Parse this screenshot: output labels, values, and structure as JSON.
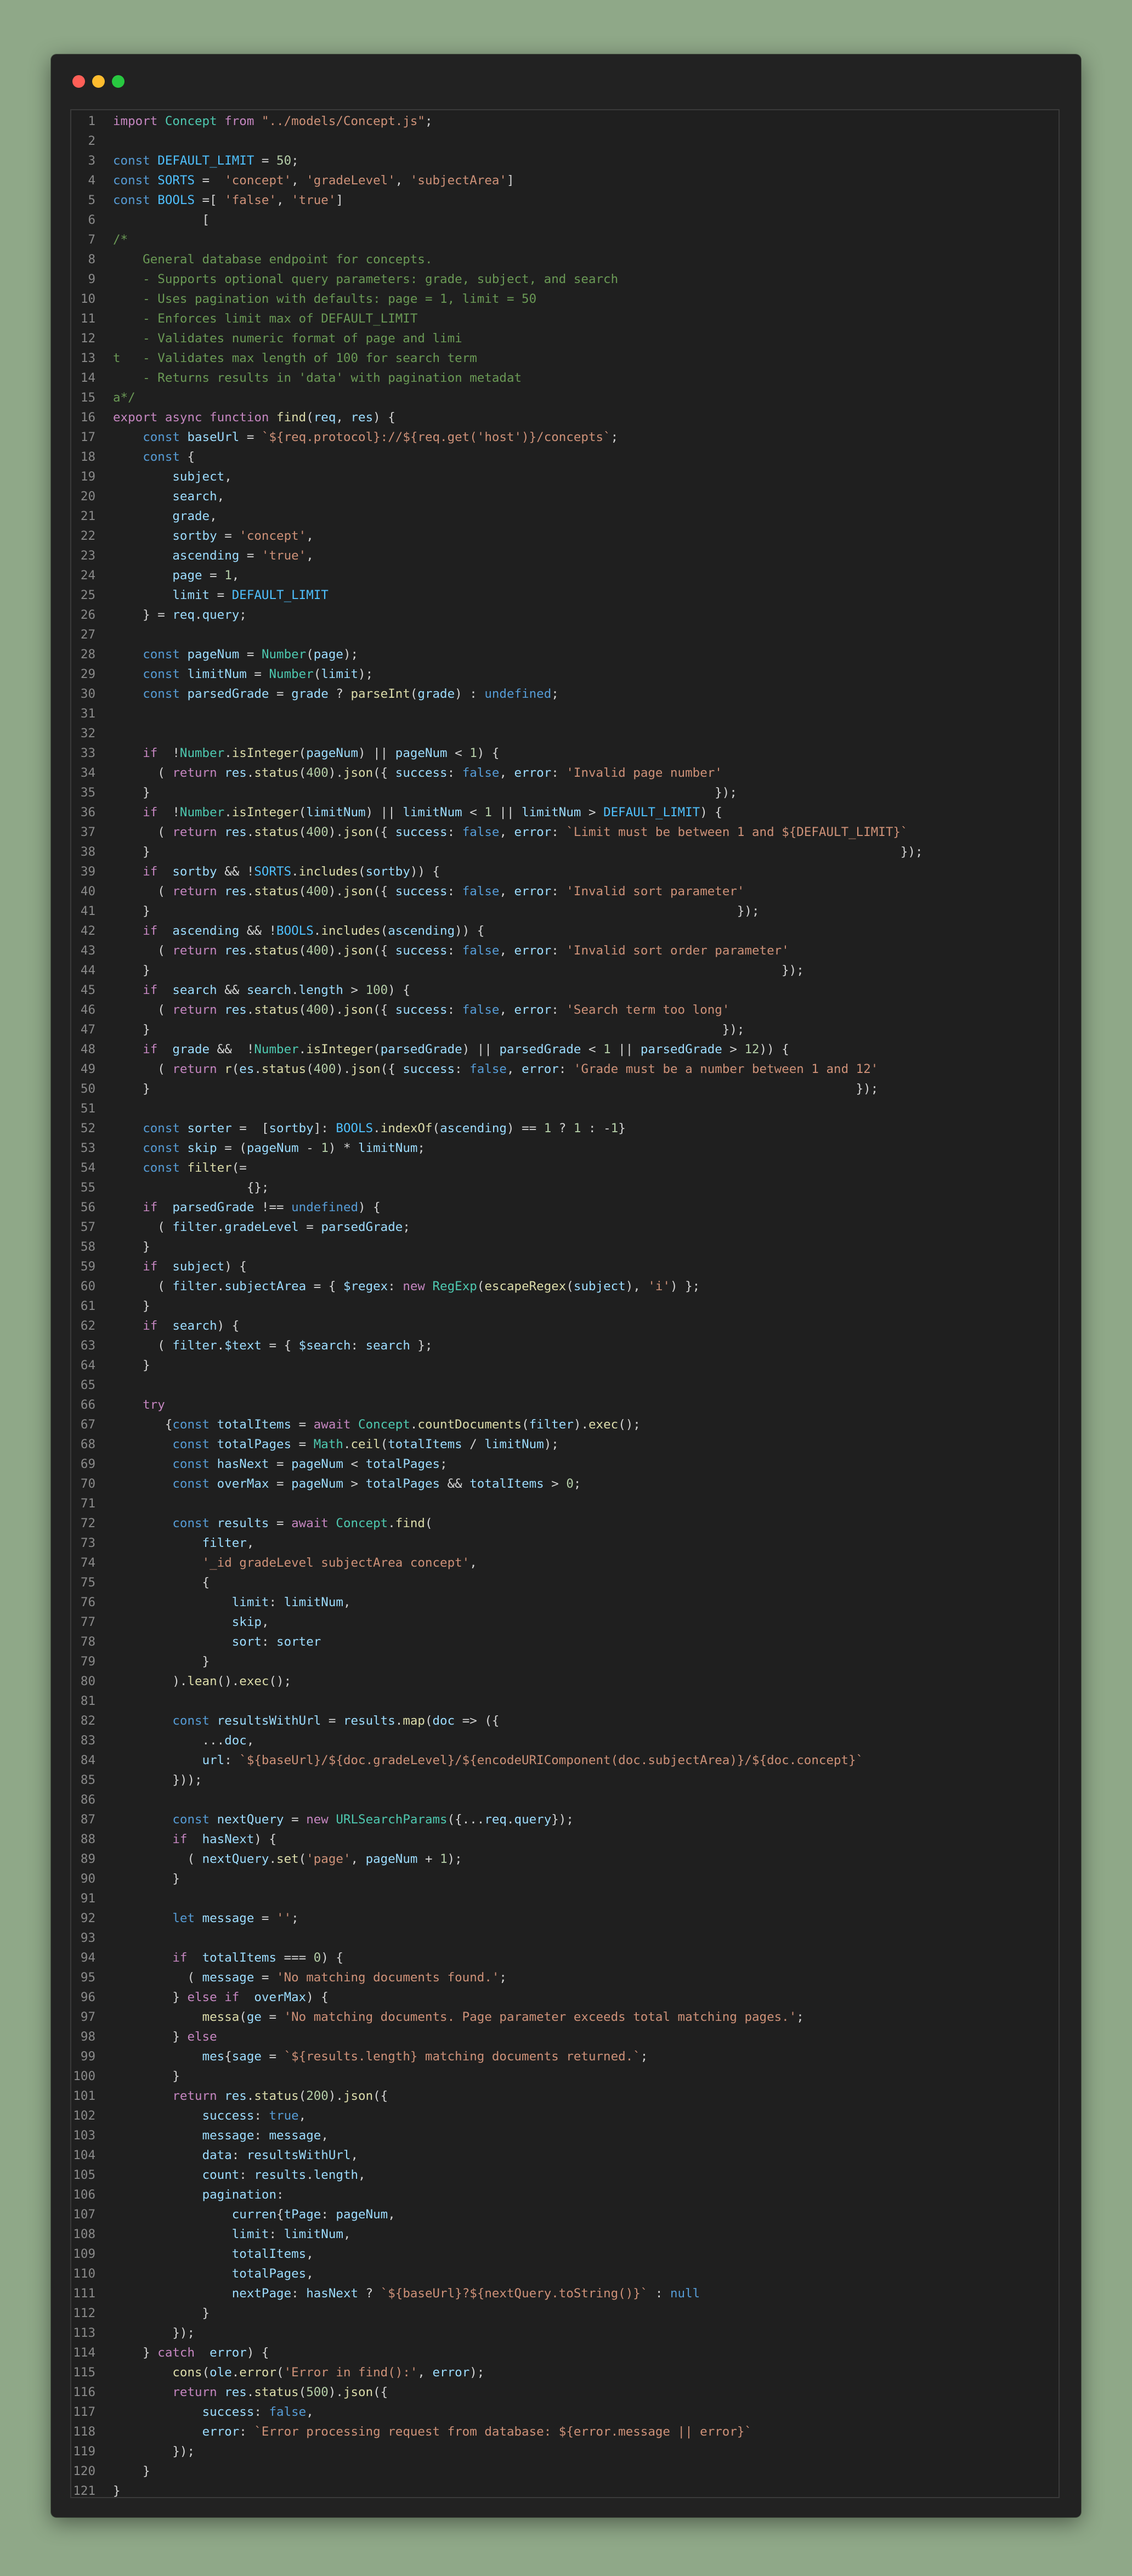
{
  "window": {
    "traffic_lights": [
      {
        "name": "close",
        "color": "#ff5f57"
      },
      {
        "name": "minimize",
        "color": "#febc2e"
      },
      {
        "name": "zoom",
        "color": "#28c840"
      }
    ]
  },
  "editor": {
    "language": "javascript",
    "line_count": 121,
    "lines": [
      "import Concept from \"../models/Concept.js\";",
      "",
      "const DEFAULT_LIMIT = 50;",
      "const SORTS =  'concept', 'gradeLevel', 'subjectArea']",
      "const BOOLS =[ 'false', 'true']",
      "            [",
      "/*",
      "    General database endpoint for concepts.",
      "    - Supports optional query parameters: grade, subject, and search",
      "    - Uses pagination with defaults: page = 1, limit = 50",
      "    - Enforces limit max of DEFAULT_LIMIT",
      "    - Validates numeric format of page and limi",
      "t   - Validates max length of 100 for search term",
      "    - Returns results in 'data' with pagination metadat",
      "a*/",
      "export async function find(req, res) {",
      "    const baseUrl = `${req.protocol}://${req.get('host')}/concepts`;",
      "    const {",
      "        subject,",
      "        search,",
      "        grade,",
      "        sortby = 'concept',",
      "        ascending = 'true',",
      "        page = 1,",
      "        limit = DEFAULT_LIMIT",
      "    } = req.query;",
      "",
      "    const pageNum = Number(page);",
      "    const limitNum = Number(limit);",
      "    const parsedGrade = grade ? parseInt(grade) : undefined;",
      "",
      "",
      "    if  !Number.isInteger(pageNum) || pageNum < 1) {",
      "      ( return res.status(400).json({ success: false, error: 'Invalid page number'",
      "    }                                                                            });",
      "    if  !Number.isInteger(limitNum) || limitNum < 1 || limitNum > DEFAULT_LIMIT) {",
      "      ( return res.status(400).json({ success: false, error: `Limit must be between 1 and ${DEFAULT_LIMIT}`",
      "    }                                                                                                     });",
      "    if  sortby && !SORTS.includes(sortby)) {",
      "      ( return res.status(400).json({ success: false, error: 'Invalid sort parameter'",
      "    }                                                                               });",
      "    if  ascending && !BOOLS.includes(ascending)) {",
      "      ( return res.status(400).json({ success: false, error: 'Invalid sort order parameter'",
      "    }                                                                                     });",
      "    if  search && search.length > 100) {",
      "      ( return res.status(400).json({ success: false, error: 'Search term too long'",
      "    }                                                                             });",
      "    if  grade &&  !Number.isInteger(parsedGrade) || parsedGrade < 1 || parsedGrade > 12)) {",
      "      ( return r(es.status(400).json({ success: false, error: 'Grade must be a number between 1 and 12'",
      "    }                                                                                               });",
      "",
      "    const sorter =  [sortby]: BOOLS.indexOf(ascending) == 1 ? 1 : -1}",
      "    const skip = (pageNum - 1) * limitNum;",
      "    const filter(=",
      "                  {};",
      "    if  parsedGrade !== undefined) {",
      "      ( filter.gradeLevel = parsedGrade;",
      "    }",
      "    if  subject) {",
      "      ( filter.subjectArea = { $regex: new RegExp(escapeRegex(subject), 'i') };",
      "    }",
      "    if  search) {",
      "      ( filter.$text = { $search: search };",
      "    }",
      "",
      "    try",
      "       {const totalItems = await Concept.countDocuments(filter).exec();",
      "        const totalPages = Math.ceil(totalItems / limitNum);",
      "        const hasNext = pageNum < totalPages;",
      "        const overMax = pageNum > totalPages && totalItems > 0;",
      "",
      "        const results = await Concept.find(",
      "            filter,",
      "            '_id gradeLevel subjectArea concept',",
      "            {",
      "                limit: limitNum,",
      "                skip,",
      "                sort: sorter",
      "            }",
      "        ).lean().exec();",
      "",
      "        const resultsWithUrl = results.map(doc => ({",
      "            ...doc,",
      "            url: `${baseUrl}/${doc.gradeLevel}/${encodeURIComponent(doc.subjectArea)}/${doc.concept}`",
      "        }));",
      "",
      "        const nextQuery = new URLSearchParams({...req.query});",
      "        if  hasNext) {",
      "          ( nextQuery.set('page', pageNum + 1);",
      "        }",
      "",
      "        let message = '';",
      "",
      "        if  totalItems === 0) {",
      "          ( message = 'No matching documents found.';",
      "        } else if  overMax) {",
      "            messa(ge = 'No matching documents. Page parameter exceeds total matching pages.';",
      "        } else",
      "            mes{sage = `${results.length} matching documents returned.`;",
      "        }",
      "        return res.status(200).json({",
      "            success: true,",
      "            message: message,",
      "            data: resultsWithUrl,",
      "            count: results.length,",
      "            pagination:",
      "                curren{tPage: pageNum,",
      "                limit: limitNum,",
      "                totalItems,",
      "                totalPages,",
      "                nextPage: hasNext ? `${baseUrl}?${nextQuery.toString()}` : null",
      "            }",
      "        });",
      "    } catch  error) {",
      "        cons(ole.error('Error in find():', error);",
      "        return res.status(500).json({",
      "            success: false,",
      "            error: `Error processing request from database: ${error.message || error}`",
      "        });",
      "    }",
      "}"
    ]
  }
}
